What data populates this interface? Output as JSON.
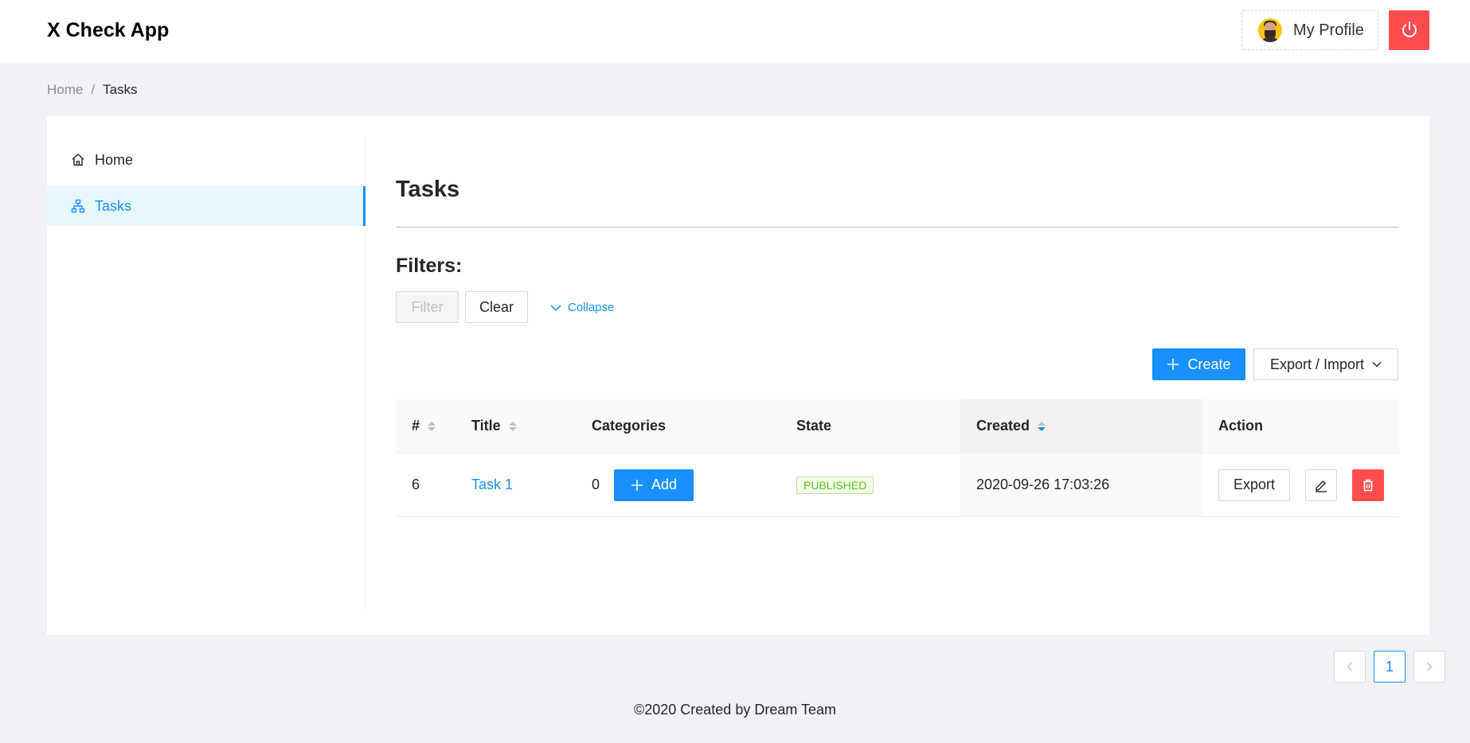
{
  "header": {
    "app_title": "X Check App",
    "profile_label": "My Profile"
  },
  "breadcrumb": {
    "items": [
      "Home",
      "Tasks"
    ],
    "separator": "/"
  },
  "sidebar": {
    "items": [
      {
        "label": "Home",
        "icon": "home-icon",
        "active": false
      },
      {
        "label": "Tasks",
        "icon": "sitemap-icon",
        "active": true
      }
    ]
  },
  "main": {
    "title": "Tasks",
    "filters_title": "Filters:",
    "filter_label": "Filter",
    "clear_label": "Clear",
    "collapse_label": "Collapse",
    "create_label": "Create",
    "export_import_label": "Export / Import"
  },
  "table": {
    "columns": [
      "#",
      "Title",
      "Categories",
      "State",
      "Created",
      "Action"
    ],
    "rows": [
      {
        "id": "6",
        "title": "Task 1",
        "categories_count": "0",
        "add_label": "Add",
        "state": "PUBLISHED",
        "created": "2020-09-26 17:03:26",
        "export_label": "Export"
      }
    ]
  },
  "pagination": {
    "current": "1"
  },
  "footer": {
    "text": "©2020 Created by Dream Team"
  },
  "colors": {
    "primary": "#1890ff",
    "danger": "#ff4d4f",
    "success": "#52c41a"
  }
}
